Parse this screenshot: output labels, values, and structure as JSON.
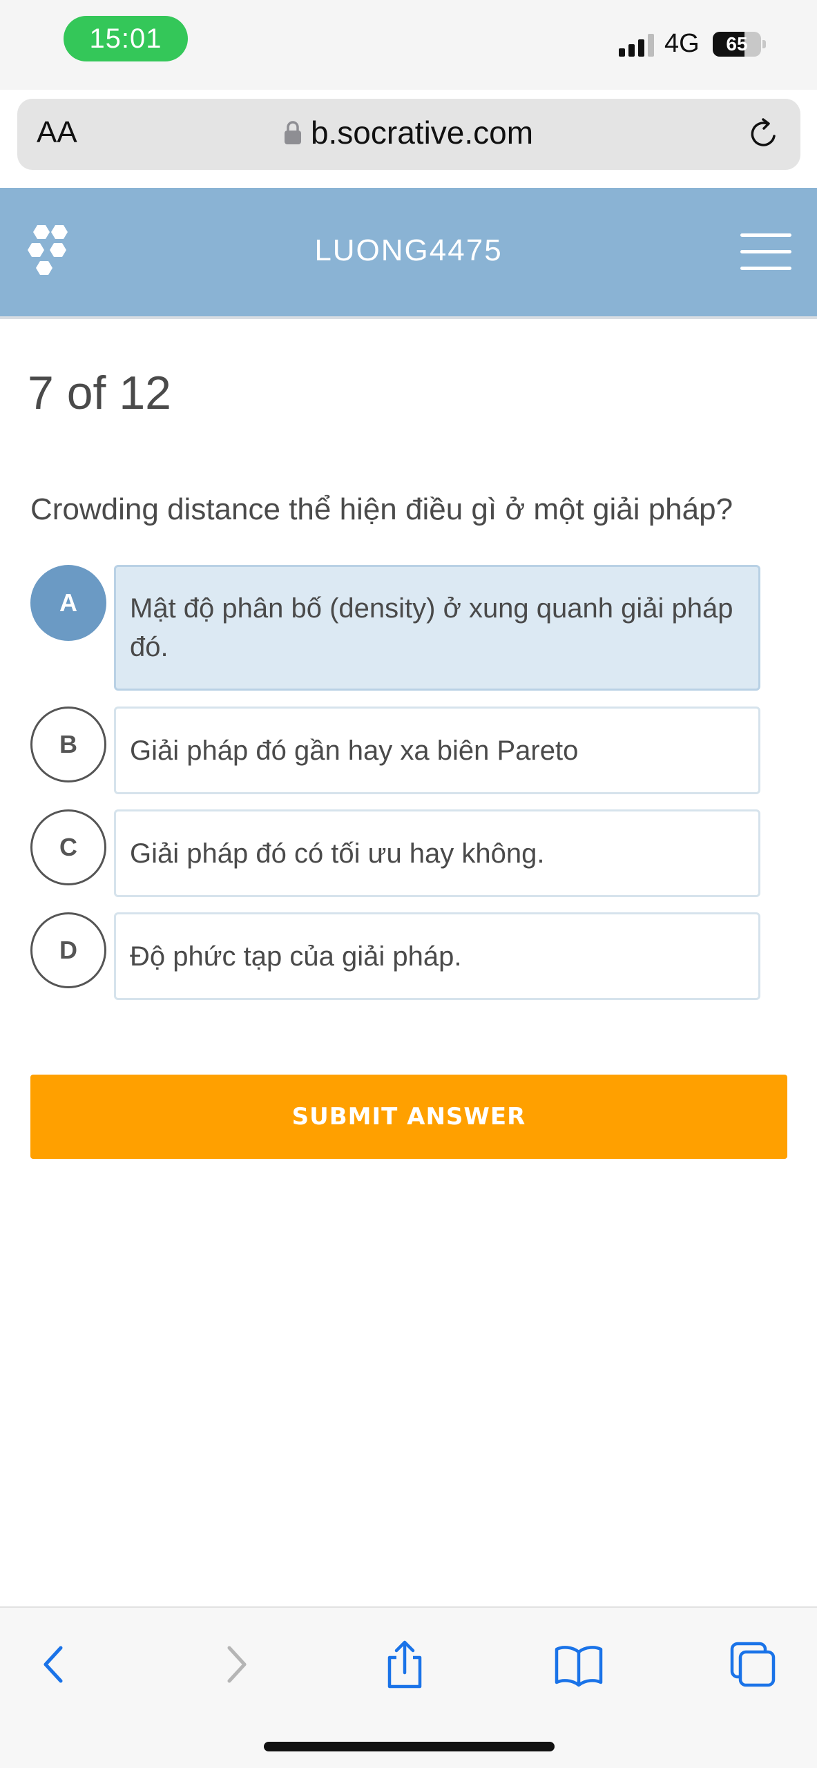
{
  "status_bar": {
    "time": "15:01",
    "network": "4G",
    "battery_percent": "65",
    "battery_level": 0.65
  },
  "browser": {
    "text_size_button": "AA",
    "url": "b.socrative.com"
  },
  "header": {
    "room_name": "LUONG4475"
  },
  "quiz": {
    "progress": "7 of 12",
    "question": "Crowding distance thể hiện điều gì ở một giải pháp?",
    "selected": "A",
    "options": [
      {
        "letter": "A",
        "text": "Mật độ phân bố (density) ở xung quanh giải pháp đó."
      },
      {
        "letter": "B",
        "text": "Giải pháp đó gần hay xa biên Pareto"
      },
      {
        "letter": "C",
        "text": "Giải pháp đó có tối ưu hay không."
      },
      {
        "letter": "D",
        "text": "Độ phức tạp của giải pháp."
      }
    ],
    "submit_label": "SUBMIT ANSWER"
  },
  "colors": {
    "header_bg": "#8ab3d4",
    "selected_badge": "#6b9ac4",
    "selected_option_bg": "#dce9f3",
    "submit_bg": "#ffa000",
    "ios_link_blue": "#1a73e8",
    "time_pill": "#34c759"
  },
  "icons": {
    "toolbar": [
      "back-icon",
      "forward-icon",
      "share-icon",
      "bookmarks-icon",
      "tabs-icon"
    ]
  }
}
